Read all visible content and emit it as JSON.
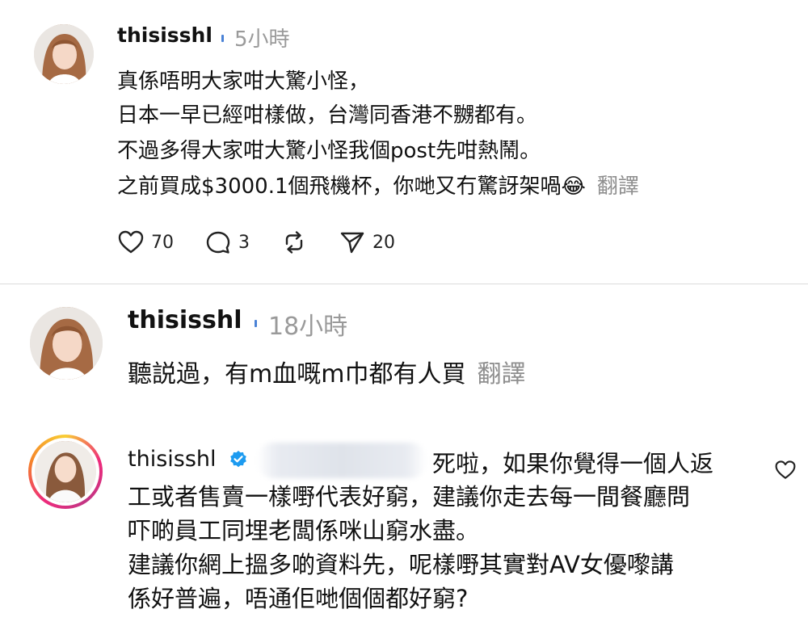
{
  "post": {
    "username": "thisisshl",
    "time": "5小時",
    "lines": [
      "真係唔明大家咁大驚小怪，",
      "日本一早已經咁樣做，台灣同香港不嬲都有。",
      "不過多得大家咁大驚小怪我個post先咁熱鬧。",
      "之前買成$3000.1個飛機杯，你哋又冇驚訝架喎😂"
    ],
    "translate": "翻譯",
    "likes": "70",
    "comments": "3",
    "shares": "20"
  },
  "reply1": {
    "username": "thisisshl",
    "time": "18小時",
    "text": "聽説過，有m血嘅m巾都有人買",
    "translate": "翻譯"
  },
  "reply2": {
    "username": "thisisshl",
    "lines": [
      "死啦，如果你覺得一個人返",
      "工或者售賣一樣嘢代表好窮，建議你走去每一間餐廳問",
      "吓啲員工同埋老闆係咪山窮水盡。",
      "建議你網上搵多啲資料先，呢樣嘢其實對AV女優嚟講",
      "係好普遍，唔通佢哋個個都好窮?"
    ]
  },
  "icons": {
    "verified": "verified-badge-icon",
    "like": "heart-icon",
    "comment": "comment-bubble-icon",
    "repost": "repost-icon",
    "share": "send-icon"
  },
  "colors": {
    "verified": "#1d9bf0",
    "secondary_text": "#9a9a9a"
  }
}
